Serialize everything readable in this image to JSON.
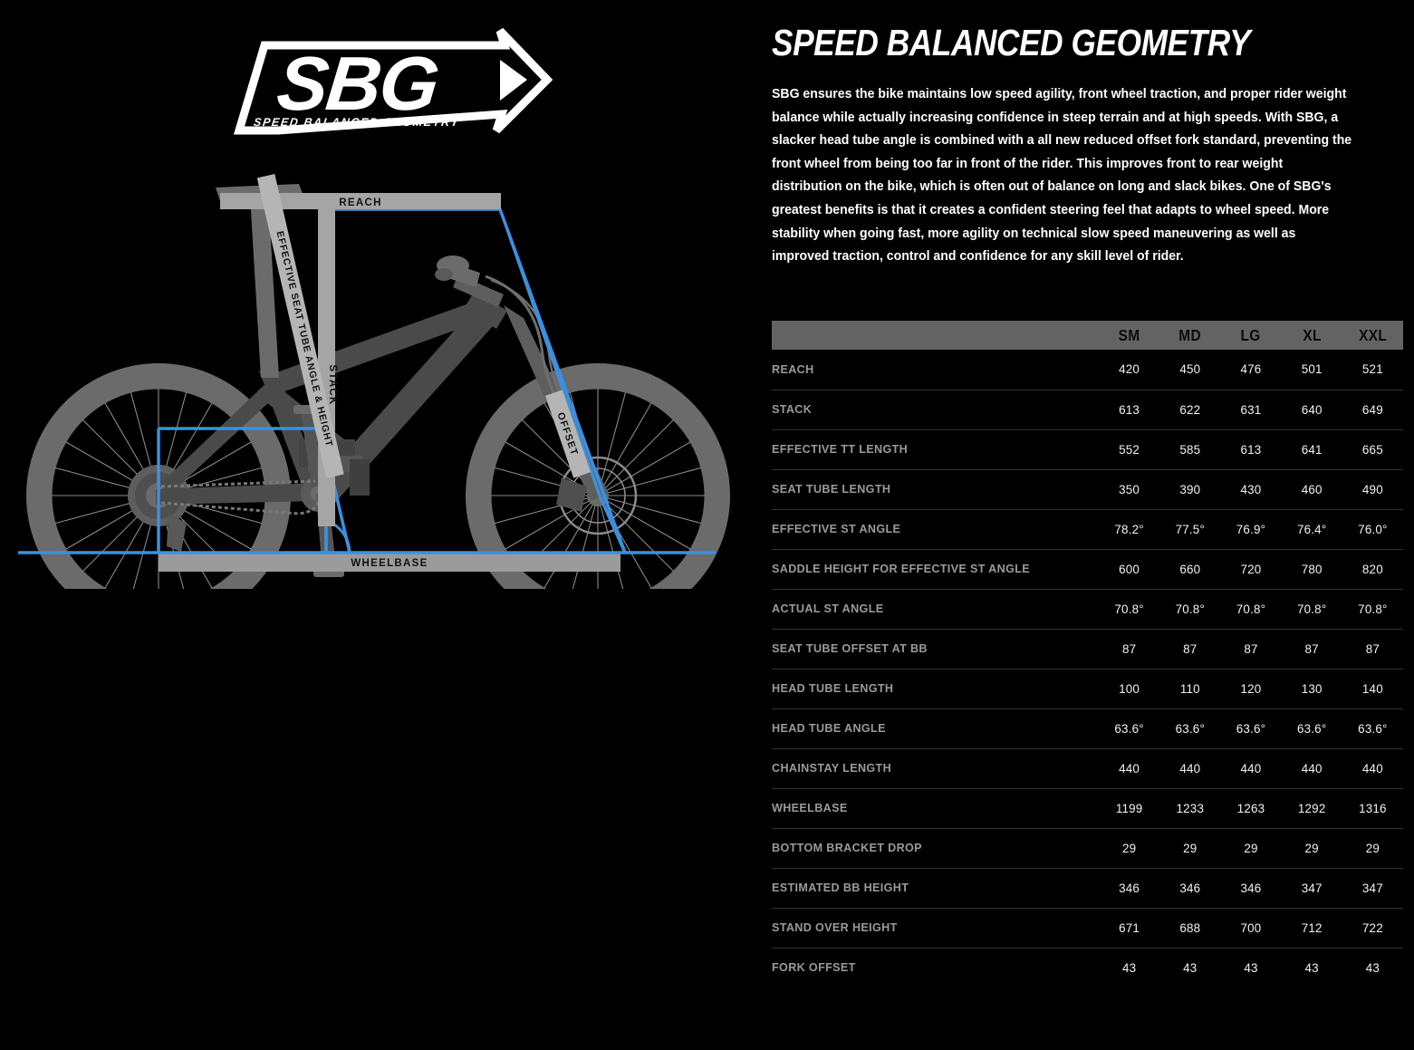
{
  "logo": {
    "mark_text": "SBG",
    "tagline": "SPEED BALANCED GEOMETRY",
    "shape": "arrow-badge"
  },
  "diagram": {
    "name": "bike-geometry-diagram",
    "accent_color": "#3d8fdd",
    "frame_color": "#4a4a4a",
    "wheel_color": "#6b6b6b",
    "labels": {
      "reach": "REACH",
      "stack": "STACK",
      "seat_tube": "EFFECTIVE SEAT TUBE ANGLE & HEIGHT",
      "offset": "OFFSET",
      "wheelbase": "WHEELBASE"
    }
  },
  "content": {
    "headline": "SPEED BALANCED GEOMETRY",
    "paragraph": "SBG ensures the bike maintains low speed agility, front wheel traction, and proper rider weight balance while actually increasing confidence in steep terrain and at high speeds. With SBG, a slacker head tube angle is combined with a all new reduced offset fork standard, preventing the front wheel from being too far in front of the rider. This improves front to rear weight distribution on the bike, which is often out of balance on long and slack bikes. One of SBG's greatest benefits is that it creates a confident steering feel that adapts to wheel speed. More stability when going fast, more agility on technical slow speed maneuvering as well as improved traction, control and confidence for any skill level of rider."
  },
  "table": {
    "spec_column_header": "",
    "sizes": [
      "SM",
      "MD",
      "LG",
      "XL",
      "XXL"
    ],
    "rows": [
      {
        "spec": "REACH",
        "values": [
          "420",
          "450",
          "476",
          "501",
          "521"
        ]
      },
      {
        "spec": "STACK",
        "values": [
          "613",
          "622",
          "631",
          "640",
          "649"
        ]
      },
      {
        "spec": "EFFECTIVE TT LENGTH",
        "values": [
          "552",
          "585",
          "613",
          "641",
          "665"
        ]
      },
      {
        "spec": "SEAT TUBE LENGTH",
        "values": [
          "350",
          "390",
          "430",
          "460",
          "490"
        ]
      },
      {
        "spec": "EFFECTIVE ST ANGLE",
        "values": [
          "78.2°",
          "77.5°",
          "76.9°",
          "76.4°",
          "76.0°"
        ]
      },
      {
        "spec": "SADDLE HEIGHT FOR EFFECTIVE ST ANGLE",
        "values": [
          "600",
          "660",
          "720",
          "780",
          "820"
        ]
      },
      {
        "spec": "ACTUAL ST ANGLE",
        "values": [
          "70.8°",
          "70.8°",
          "70.8°",
          "70.8°",
          "70.8°"
        ]
      },
      {
        "spec": "SEAT TUBE OFFSET AT BB",
        "values": [
          "87",
          "87",
          "87",
          "87",
          "87"
        ]
      },
      {
        "spec": "HEAD TUBE LENGTH",
        "values": [
          "100",
          "110",
          "120",
          "130",
          "140"
        ]
      },
      {
        "spec": "HEAD TUBE ANGLE",
        "values": [
          "63.6°",
          "63.6°",
          "63.6°",
          "63.6°",
          "63.6°"
        ]
      },
      {
        "spec": "CHAINSTAY LENGTH",
        "values": [
          "440",
          "440",
          "440",
          "440",
          "440"
        ]
      },
      {
        "spec": "WHEELBASE",
        "values": [
          "1199",
          "1233",
          "1263",
          "1292",
          "1316"
        ]
      },
      {
        "spec": "BOTTOM BRACKET DROP",
        "values": [
          "29",
          "29",
          "29",
          "29",
          "29"
        ]
      },
      {
        "spec": "ESTIMATED BB HEIGHT",
        "values": [
          "346",
          "346",
          "346",
          "347",
          "347"
        ]
      },
      {
        "spec": "STAND OVER HEIGHT",
        "values": [
          "671",
          "688",
          "700",
          "712",
          "722"
        ]
      },
      {
        "spec": "FORK OFFSET",
        "values": [
          "43",
          "43",
          "43",
          "43",
          "43"
        ]
      }
    ]
  }
}
